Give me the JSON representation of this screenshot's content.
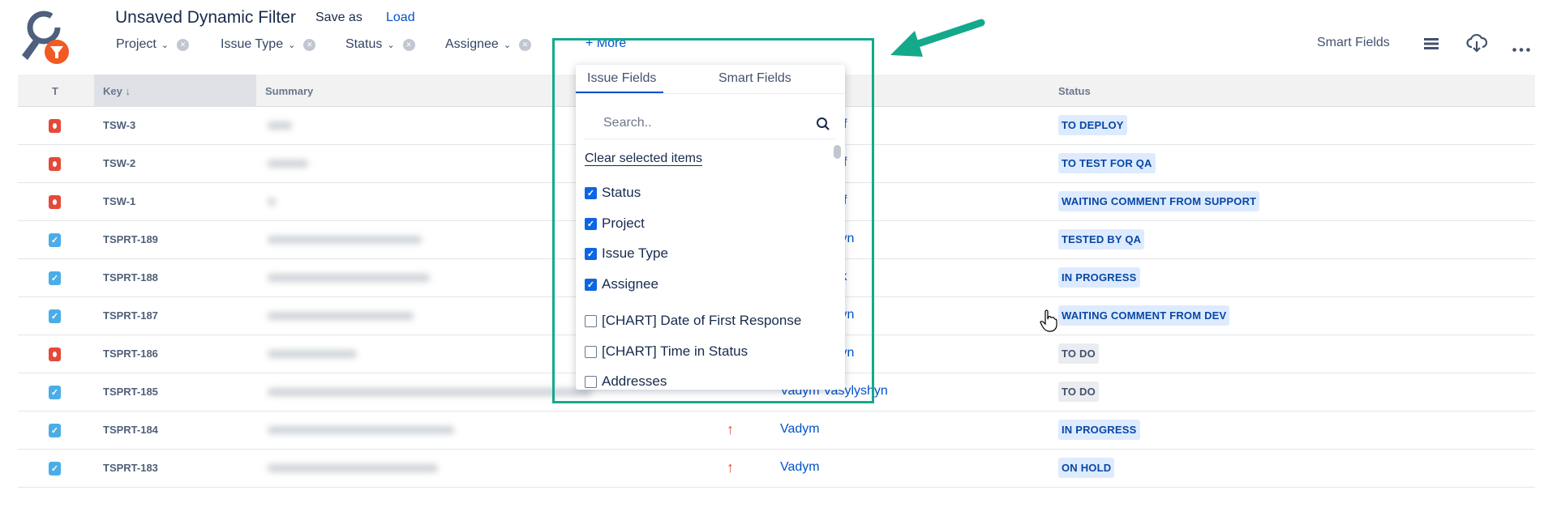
{
  "header": {
    "title": "Unsaved Dynamic Filter",
    "save_as": "Save as",
    "load": "Load"
  },
  "filters": [
    {
      "label": "Project"
    },
    {
      "label": "Issue Type"
    },
    {
      "label": "Status"
    },
    {
      "label": "Assignee"
    }
  ],
  "more_label": "+ More",
  "toolbar": {
    "smart_fields": "Smart Fields",
    "icons": [
      "hamburger-icon",
      "cloud-download-icon",
      "more-icon"
    ]
  },
  "table": {
    "columns": {
      "t": "T",
      "key": "Key ↓",
      "summary": "Summary",
      "status": "Status"
    },
    "rows": [
      {
        "type": "bug",
        "key": "TSW-3",
        "assignee": "f",
        "priority": "",
        "status": "TO DEPLOY",
        "style": "blue"
      },
      {
        "type": "bug",
        "key": "TSW-2",
        "assignee": "f",
        "priority": "",
        "status": "TO TEST FOR QA",
        "style": "blue"
      },
      {
        "type": "bug",
        "key": "TSW-1",
        "assignee": "f",
        "priority": "",
        "status": "WAITING COMMENT FROM SUPPORT",
        "style": "blue"
      },
      {
        "type": "task",
        "key": "TSPRT-189",
        "assignee": "ylyshyn",
        "priority": "",
        "status": "TESTED BY QA",
        "style": "blue"
      },
      {
        "type": "task",
        "key": "TSPRT-188",
        "assignee": "mbrak",
        "priority": "",
        "status": "IN PROGRESS",
        "style": "blue"
      },
      {
        "type": "task",
        "key": "TSPRT-187",
        "assignee": "ylyshyn",
        "priority": "",
        "status": "WAITING COMMENT FROM DEV",
        "style": "blue"
      },
      {
        "type": "bug",
        "key": "TSPRT-186",
        "assignee": "ylyshyn",
        "priority": "",
        "status": "TO DO",
        "style": "grey"
      },
      {
        "type": "task",
        "key": "TSPRT-185",
        "assignee": "Vadym Vasylyshyn",
        "priority": "",
        "status": "TO DO",
        "style": "grey"
      },
      {
        "type": "task",
        "key": "TSPRT-184",
        "assignee": "Vadym",
        "priority": "↑",
        "status": "IN PROGRESS",
        "style": "blue"
      },
      {
        "type": "task",
        "key": "TSPRT-183",
        "assignee": "Vadym",
        "priority": "↑",
        "status": "ON HOLD",
        "style": "blue"
      }
    ]
  },
  "popup": {
    "tabs": [
      "Issue Fields",
      "Smart Fields"
    ],
    "search_placeholder": "Search..",
    "clear": "Clear selected items",
    "items": [
      {
        "label": "Status",
        "checked": true
      },
      {
        "label": "Project",
        "checked": true
      },
      {
        "label": "Issue Type",
        "checked": true
      },
      {
        "label": "Assignee",
        "checked": true
      },
      {
        "label": "[CHART] Date of First Response",
        "checked": false
      },
      {
        "label": "[CHART] Time in Status",
        "checked": false
      },
      {
        "label": "Addresses",
        "checked": false
      }
    ]
  },
  "colors": {
    "accent": "#0052cc",
    "highlight": "#14a98b",
    "bug": "#e5493a",
    "task": "#4bade8"
  }
}
